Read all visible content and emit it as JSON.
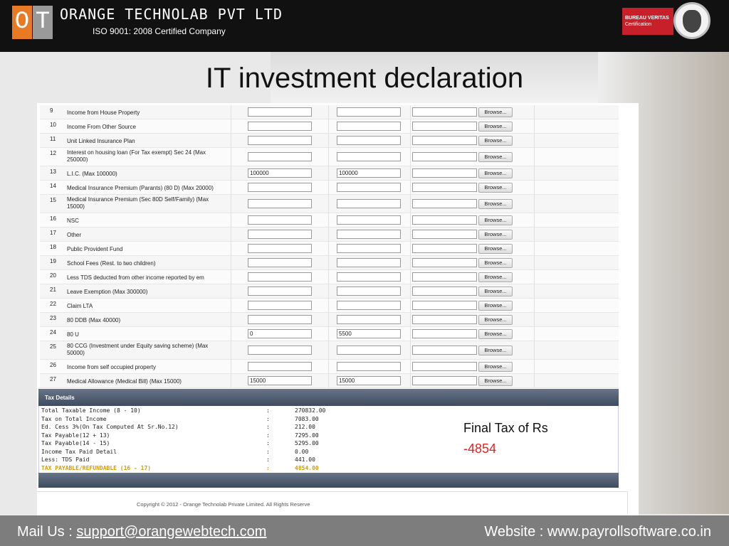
{
  "header": {
    "logo_left": "O",
    "logo_right": "T",
    "company": "ORANGE TECHNOLAB PVT LTD",
    "iso": "ISO 9001: 2008 Certified Company",
    "cert_name": "BUREAU VERITAS",
    "cert_sub": "Certification",
    "brand_color": "#e87a24"
  },
  "title": "IT investment declaration",
  "rows": [
    {
      "num": "9",
      "desc": "Income from House Property",
      "v1": "",
      "v2": ""
    },
    {
      "num": "10",
      "desc": "Income From Other Source",
      "v1": "",
      "v2": ""
    },
    {
      "num": "11",
      "desc": "Unit Linked Insurance Plan",
      "v1": "",
      "v2": ""
    },
    {
      "num": "12",
      "desc": "Interest on housing loan (For Tax exempt) Sec 24 (Max 250000)",
      "v1": "",
      "v2": ""
    },
    {
      "num": "13",
      "desc": "L.I.C. (Max 100000)",
      "v1": "100000",
      "v2": "100000"
    },
    {
      "num": "14",
      "desc": "Medical Insurance Premium (Parants) (80 D) (Max 20000)",
      "v1": "",
      "v2": ""
    },
    {
      "num": "15",
      "desc": "Medical Insurance Premium (Sec 80D Self/Family) (Max 15000)",
      "v1": "",
      "v2": ""
    },
    {
      "num": "16",
      "desc": "NSC",
      "v1": "",
      "v2": ""
    },
    {
      "num": "17",
      "desc": "Other",
      "v1": "",
      "v2": ""
    },
    {
      "num": "18",
      "desc": "Public Provident Fund",
      "v1": "",
      "v2": ""
    },
    {
      "num": "19",
      "desc": "School Fees (Rest. to two children)",
      "v1": "",
      "v2": ""
    },
    {
      "num": "20",
      "desc": "Less TDS deducted from other income reported by em",
      "v1": "",
      "v2": ""
    },
    {
      "num": "21",
      "desc": "Leave Exemption (Max 300000)",
      "v1": "",
      "v2": ""
    },
    {
      "num": "22",
      "desc": "Claim LTA",
      "v1": "",
      "v2": ""
    },
    {
      "num": "23",
      "desc": "80 DDB (Max 40000)",
      "v1": "",
      "v2": ""
    },
    {
      "num": "24",
      "desc": "80 U",
      "v1": "0",
      "v2": "5500"
    },
    {
      "num": "25",
      "desc": "80 CCG (Investment under Equity saving scheme) (Max 50000)",
      "v1": "",
      "v2": ""
    },
    {
      "num": "26",
      "desc": "Income from self occupied property",
      "v1": "",
      "v2": ""
    },
    {
      "num": "27",
      "desc": "Medical Allowance (Medical Bill) (Max 15000)",
      "v1": "15000",
      "v2": "15000"
    }
  ],
  "browse_label": "Browse...",
  "tax": {
    "heading": "Tax Details",
    "lines": [
      {
        "label": "Total Taxable Income (8 - 10)",
        "sep": ":",
        "value": "270832.00"
      },
      {
        "label": "Tax on Total Income",
        "sep": ":",
        "value": "7083.00"
      },
      {
        "label": "Ed. Cess 3%(On Tax Computed At Sr.No.12)",
        "sep": ":",
        "value": "212.00"
      },
      {
        "label": "Tax Payable(12 + 13)",
        "sep": ":",
        "value": "7295.00"
      },
      {
        "label": "Tax Payable(14 - 15)",
        "sep": ":",
        "value": "5295.00"
      },
      {
        "label": "Income Tax Paid Detail",
        "sep": ":",
        "value": "0.00"
      },
      {
        "label": "Less: TDS Paid",
        "sep": ":",
        "value": "441.00"
      },
      {
        "label": "TAX PAYABLE/REFUNDABLE (16 - 17)",
        "sep": ":",
        "value": "4854.00"
      }
    ],
    "highlight_color": "#d49a00"
  },
  "copyright": "Copyright © 2012 - Orange Technolab Private Limited. All Rights Reserve",
  "final": {
    "label": "Final Tax of Rs",
    "value": "-4854",
    "value_color": "#e0241b"
  },
  "footer": {
    "mail_prefix": "Mail Us : ",
    "mail": "support@orangewebtech.com",
    "website": "Website : www.payrollsoftware.co.in"
  }
}
